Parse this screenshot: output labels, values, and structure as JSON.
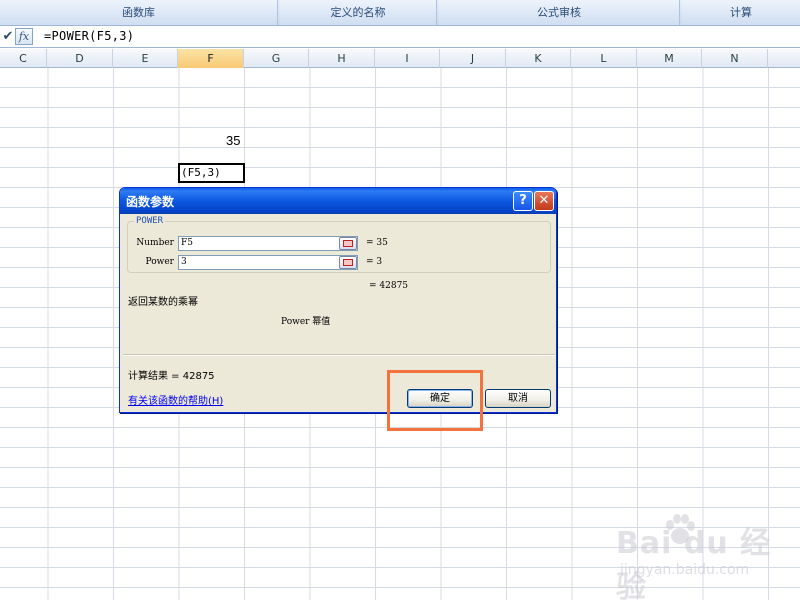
{
  "ribbon": {
    "groups": [
      "函数库",
      "定义的名称",
      "公式审核",
      "计算"
    ]
  },
  "formula_bar": {
    "check_icon": "✔",
    "fx_label": "fx",
    "formula": "=POWER(F5,3)"
  },
  "columns": [
    "C",
    "D",
    "E",
    "F",
    "G",
    "H",
    "I",
    "J",
    "K",
    "L",
    "M",
    "N"
  ],
  "selected_column": "F",
  "cells": {
    "f5_value": "35",
    "f7_edit": "(F5,3)"
  },
  "dialog": {
    "title": "函数参数",
    "help_btn": "?",
    "close_btn": "✕",
    "function_name": "POWER",
    "args": [
      {
        "label": "Number",
        "value": "F5",
        "result": "=  35"
      },
      {
        "label": "Power",
        "value": "3",
        "result": "=  3"
      }
    ],
    "total_result": "=  42875",
    "description": "返回某数的乘幂",
    "arg_description": "Power  幂值",
    "computed_result": "计算结果 =  42875",
    "help_link": "有关该函数的帮助(H)",
    "ok_label": "确定",
    "cancel_label": "取消"
  },
  "watermark": {
    "brand": "Bai du 经验",
    "url": "jingyan.baidu.com"
  },
  "colors": {
    "title_bar": "#0a58e0",
    "highlight": "#f4723c",
    "selected_column": "#f8c974"
  }
}
